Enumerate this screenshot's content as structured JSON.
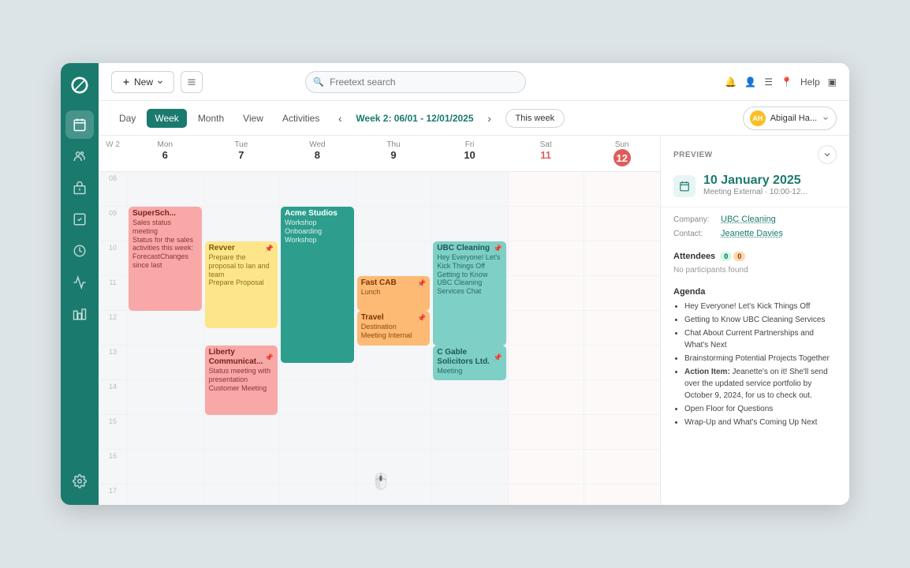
{
  "toolbar": {
    "new_label": "New",
    "search_placeholder": "Freetext search",
    "help_label": "Help"
  },
  "cal_header": {
    "views": [
      "Day",
      "Week",
      "Month",
      "View",
      "Activities"
    ],
    "active_view": "Week",
    "week_range": "Week 2: 06/01 - 12/01/2025",
    "this_week_label": "This week",
    "user_name": "Abigail Ha...",
    "user_initials": "AH"
  },
  "days": [
    {
      "name": "Mon",
      "num": "6",
      "col": "Mon 6",
      "is_weekend": false,
      "is_today": false
    },
    {
      "name": "Tue",
      "num": "7",
      "col": "Tue 7",
      "is_weekend": false,
      "is_today": false
    },
    {
      "name": "Wed",
      "num": "8",
      "col": "Wed 8",
      "is_weekend": false,
      "is_today": false
    },
    {
      "name": "Thu",
      "num": "9",
      "col": "Thu 9",
      "is_weekend": false,
      "is_today": false
    },
    {
      "name": "Fri",
      "num": "10",
      "col": "Fri 10",
      "is_weekend": false,
      "is_today": false
    },
    {
      "name": "Sat",
      "num": "11",
      "col": "Sat 11",
      "is_weekend": true,
      "is_today": false
    },
    {
      "name": "Sun",
      "num": "12",
      "col": "Sun 12",
      "is_weekend": true,
      "is_today": true
    }
  ],
  "week_num": "W 2",
  "hours": [
    "08",
    "09",
    "10",
    "11",
    "12",
    "13",
    "14",
    "15",
    "16",
    "17"
  ],
  "preview": {
    "label": "PREVIEW",
    "date": "10 January 2025",
    "subtitle": "Meeting External · 10:00-12...",
    "company_label": "Company:",
    "company_value": "UBC Cleaning",
    "contact_label": "Contact:",
    "contact_value": "Jeanette Davies",
    "attendees_label": "Attendees",
    "attendees_present": "0",
    "attendees_total": "0",
    "no_participants": "No participants found",
    "agenda_label": "Agenda",
    "agenda_items": [
      "Hey Everyone! Let's Kick Things Off",
      "Getting to Know UBC Cleaning Services",
      "Chat About Current Partnerships and What's Next",
      "Brainstorming Potential Projects Together",
      "Action Item: Jeanette's on it! She'll send over the updated service portfolio by October 9, 2024, for us to check out.",
      "Open Floor for Questions",
      "Wrap-Up and What's Coming Up Next"
    ]
  },
  "events": {
    "superscream": {
      "title": "SuperSch...",
      "sub1": "Sales status meeting",
      "sub2": "Status for the sales activities this week: ForecastChanges since last"
    },
    "revver": {
      "title": "Revver",
      "sub1": "Prepare the proposal to Ian and team",
      "sub2": "Prepare Proposal"
    },
    "acme": {
      "title": "Acme Studios",
      "sub1": "Workshop Onboarding Workshop"
    },
    "liberty": {
      "title": "Liberty Communicat...",
      "sub1": "Status meeting with presentation Customer Meeting"
    },
    "fast_cab": {
      "title": "Fast CAB",
      "sub2": "Lunch"
    },
    "travel": {
      "title": "Travel Destination",
      "sub2": "Meeting Internal"
    },
    "ubc_cleaning": {
      "title": "UBC Cleaning",
      "sub1": "Hey Everyone! Let's Kick Things Off Getting to Know UBC Cleaning Services Chat"
    },
    "c_gable": {
      "title": "C Gable Solicitors Ltd.",
      "sub2": "Meeting"
    }
  }
}
